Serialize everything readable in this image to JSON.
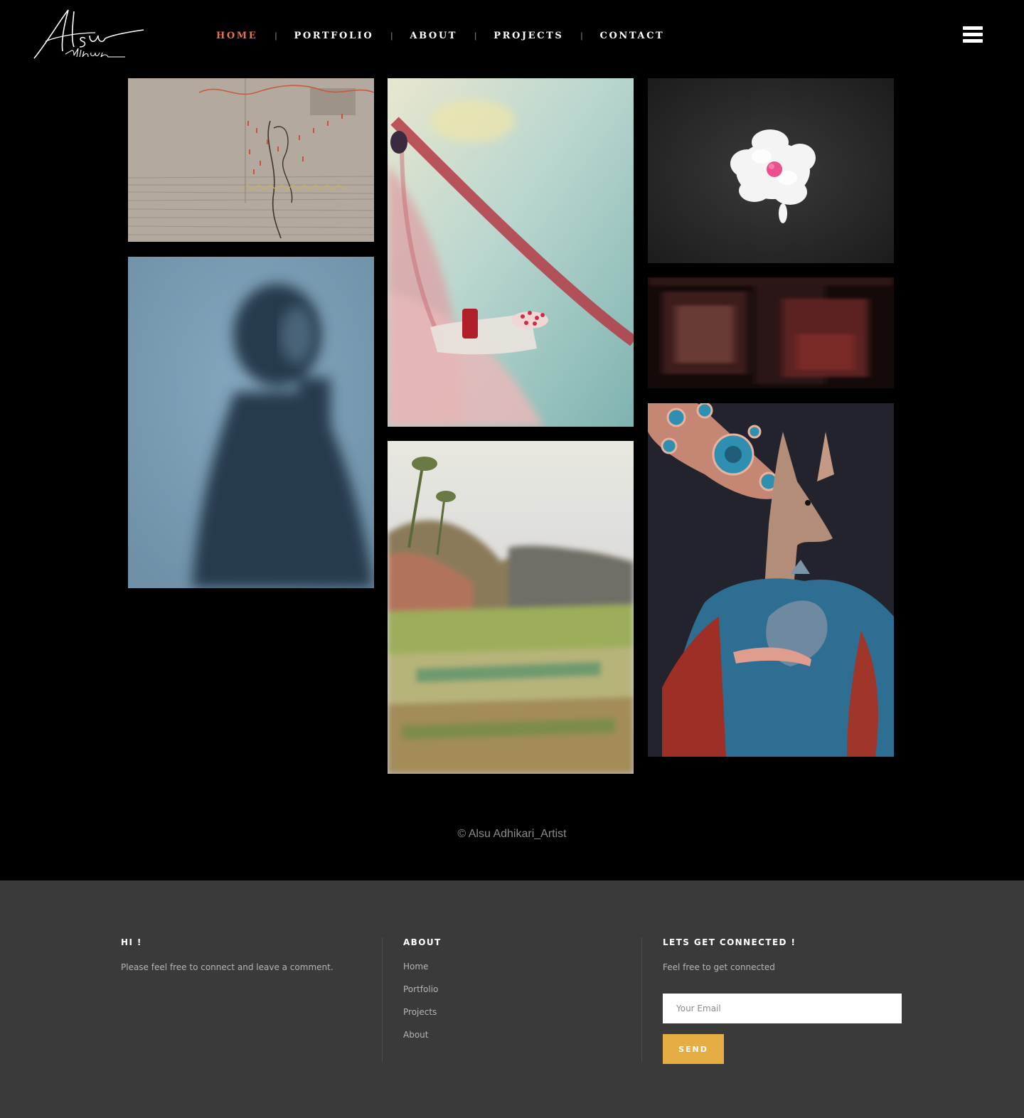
{
  "header": {
    "logo_text": "Alsu Adhikari",
    "nav": [
      {
        "label": "HOME",
        "active": true
      },
      {
        "label": "PORTFOLIO",
        "active": false
      },
      {
        "label": "ABOUT",
        "active": false
      },
      {
        "label": "PROJECTS",
        "active": false
      },
      {
        "label": "CONTACT",
        "active": false
      }
    ],
    "nav_separator": "|",
    "menu_icon": "hamburger-menu-icon",
    "active_color": "#e8734a"
  },
  "gallery": {
    "artworks": [
      {
        "name": "embroidery-on-linen",
        "palette": [
          "#b8aea3",
          "#8f8377",
          "#c0573f"
        ]
      },
      {
        "name": "blue-blurred-portrait",
        "palette": [
          "#7fa0b6",
          "#2b3f52"
        ]
      },
      {
        "name": "watercolor-red-thread",
        "palette": [
          "#cfe0d6",
          "#b7453f",
          "#e3c9c4"
        ]
      },
      {
        "name": "watercolor-landscape",
        "palette": [
          "#d8d7c9",
          "#8f7a4a",
          "#9fae5c"
        ]
      },
      {
        "name": "white-flower-on-black",
        "palette": [
          "#2a2a2a",
          "#f4f4f4",
          "#ea4f8e"
        ]
      },
      {
        "name": "dark-blurred-interior",
        "palette": [
          "#1b0d0d",
          "#5a2222"
        ]
      },
      {
        "name": "deer-woman-painting",
        "palette": [
          "#22232d",
          "#c58a76",
          "#3c7da0",
          "#9a3224"
        ]
      }
    ]
  },
  "copyright": "© Alsu Adhikari_Artist",
  "footer": {
    "col1": {
      "title": "HI !",
      "text": "Please feel free to connect and leave a comment."
    },
    "col2": {
      "title": "ABOUT",
      "links": [
        "Home",
        "Portfolio",
        "Projects",
        "About"
      ]
    },
    "col3": {
      "title": "LETS GET CONNECTED !",
      "text": "Feel free to get connected",
      "email_placeholder": "Your Email",
      "send_label": "SEND"
    },
    "button_color": "#e6ad44"
  }
}
